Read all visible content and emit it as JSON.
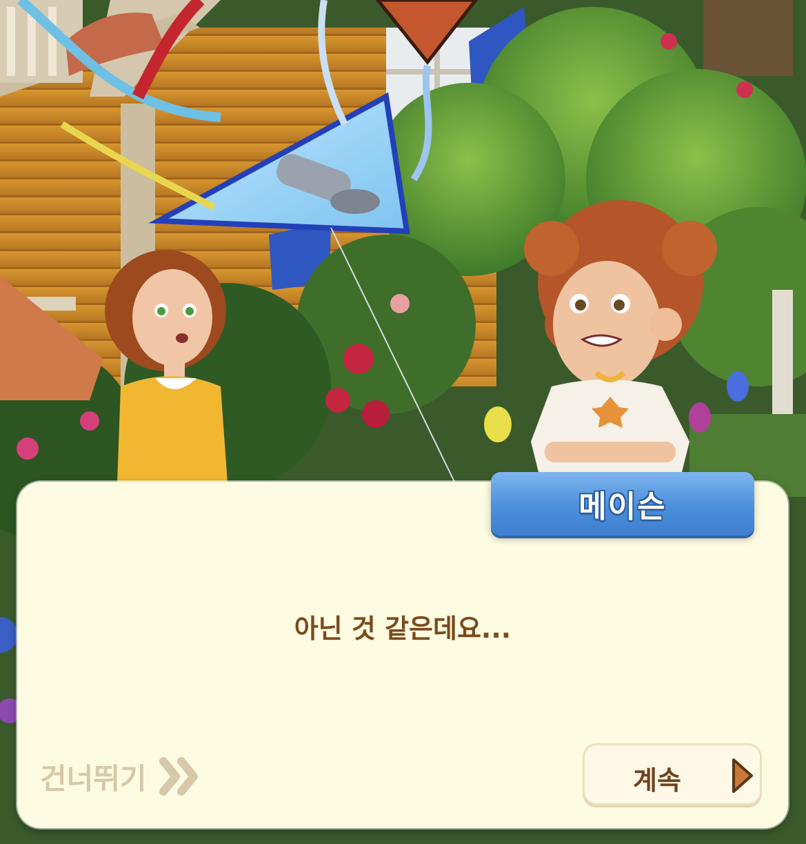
{
  "dialog": {
    "speaker_name": "메이슨",
    "line": "아닌 것 같은데요...",
    "skip_label": "건너뛰기",
    "continue_label": "계속"
  },
  "icons": {
    "skip": "double-chevron-right-icon",
    "continue": "play-triangle-icon"
  },
  "colors": {
    "dialog_background": "#fdfbe1",
    "name_tag": "#4a8fdc",
    "text_brown": "#7a4a1e",
    "skip_text": "#d6c8aa",
    "continue_arrow": "#c9773a"
  }
}
